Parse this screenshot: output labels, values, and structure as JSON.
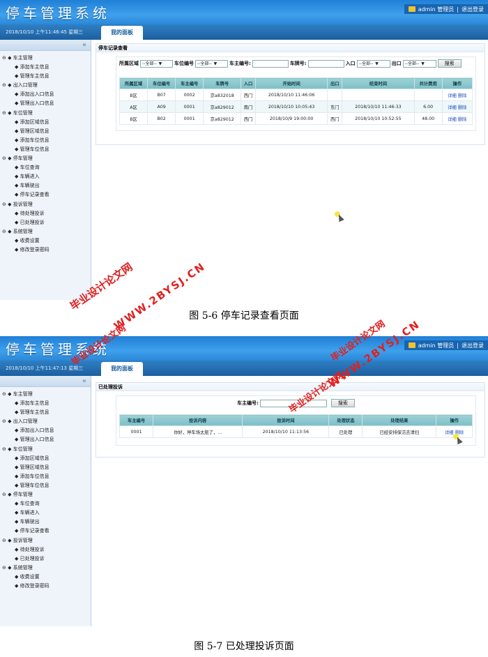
{
  "app": {
    "title": "停车管理系统",
    "user_label": "admin 管理员",
    "separator": "|",
    "logout_label": "退出登录",
    "home_tab": "我的面板"
  },
  "sidebar": {
    "collapse_symbol": "«",
    "groups": [
      {
        "label": "车主管理",
        "items": [
          "添加车主信息",
          "管理车主信息"
        ]
      },
      {
        "label": "出入口管理",
        "items": [
          "添加出入口信息",
          "管理出入口信息"
        ]
      },
      {
        "label": "车位管理",
        "items": [
          "添加区域信息",
          "管理区域信息",
          "添加车位信息",
          "管理车位信息"
        ]
      },
      {
        "label": "停车管理",
        "items": [
          "车位查询",
          "车辆进入",
          "车辆驶出",
          "停车记录查看"
        ]
      },
      {
        "label": "投诉管理",
        "items": [
          "待处理投诉",
          "已处理投诉"
        ]
      },
      {
        "label": "系统管理",
        "items": [
          "收费设置",
          "修改登录密码"
        ]
      }
    ]
  },
  "screen1": {
    "datetime": "2018/10/10 上午11:46:45 星期三",
    "panel_title": "停车记录查看",
    "filters": {
      "area_label": "所属区域",
      "area_value": "--全部--",
      "space_label": "车位编号",
      "space_value": "--全部--",
      "owner_label": "车主编号:",
      "plate_label": "车牌号:",
      "entry_label": "入口",
      "entry_value": "--全部--",
      "exit_label": "出口",
      "exit_value": "--全部--",
      "search_button": "搜索"
    },
    "table": {
      "headers": [
        "所属区域",
        "车位编号",
        "车主编号",
        "车牌号",
        "入口",
        "开始时间",
        "出口",
        "结束时间",
        "共计费用",
        "操作"
      ],
      "rows": [
        [
          "B区",
          "B07",
          "0002",
          "京a832018",
          "西门",
          "2018/10/10 11:46:06",
          "",
          "",
          "",
          "详细 删除"
        ],
        [
          "A区",
          "A09",
          "0001",
          "京a829012",
          "南门",
          "2018/10/10 10:05:43",
          "东门",
          "2018/10/10 11:46:33",
          "6.00",
          "详细 删除"
        ],
        [
          "B区",
          "B02",
          "0001",
          "京a829012",
          "西门",
          "2018/10/9 19:00:00",
          "西门",
          "2018/10/10 10:52:55",
          "48.00",
          "详细 删除"
        ]
      ]
    },
    "caption": "图 5-6 停车记录查看页面"
  },
  "screen2": {
    "datetime": "2018/10/10 上午11:47:13 星期三",
    "panel_title": "已处理投诉",
    "filters": {
      "owner_label": "车主编号:",
      "search_button": "搜索"
    },
    "table": {
      "headers": [
        "车主编号",
        "投诉内容",
        "投诉时间",
        "处理状态",
        "处理结果",
        "操作"
      ],
      "rows": [
        [
          "0001",
          "你好，停车场太脏了，...",
          "2018/10/10 11:13:56",
          "已处理",
          "已经安排保洁去清扫",
          "详细 删除"
        ]
      ]
    },
    "caption": "图 5-7 已处理投诉页面"
  },
  "watermark": {
    "line1": "毕业设计论文网",
    "line2": "WWW.2BYSJ.CN"
  },
  "colors": {
    "header_blue": "#2f8fe0",
    "table_header": "#8cc8cf",
    "watermark_red": "#e02020",
    "link_blue": "#1d4fc0"
  }
}
